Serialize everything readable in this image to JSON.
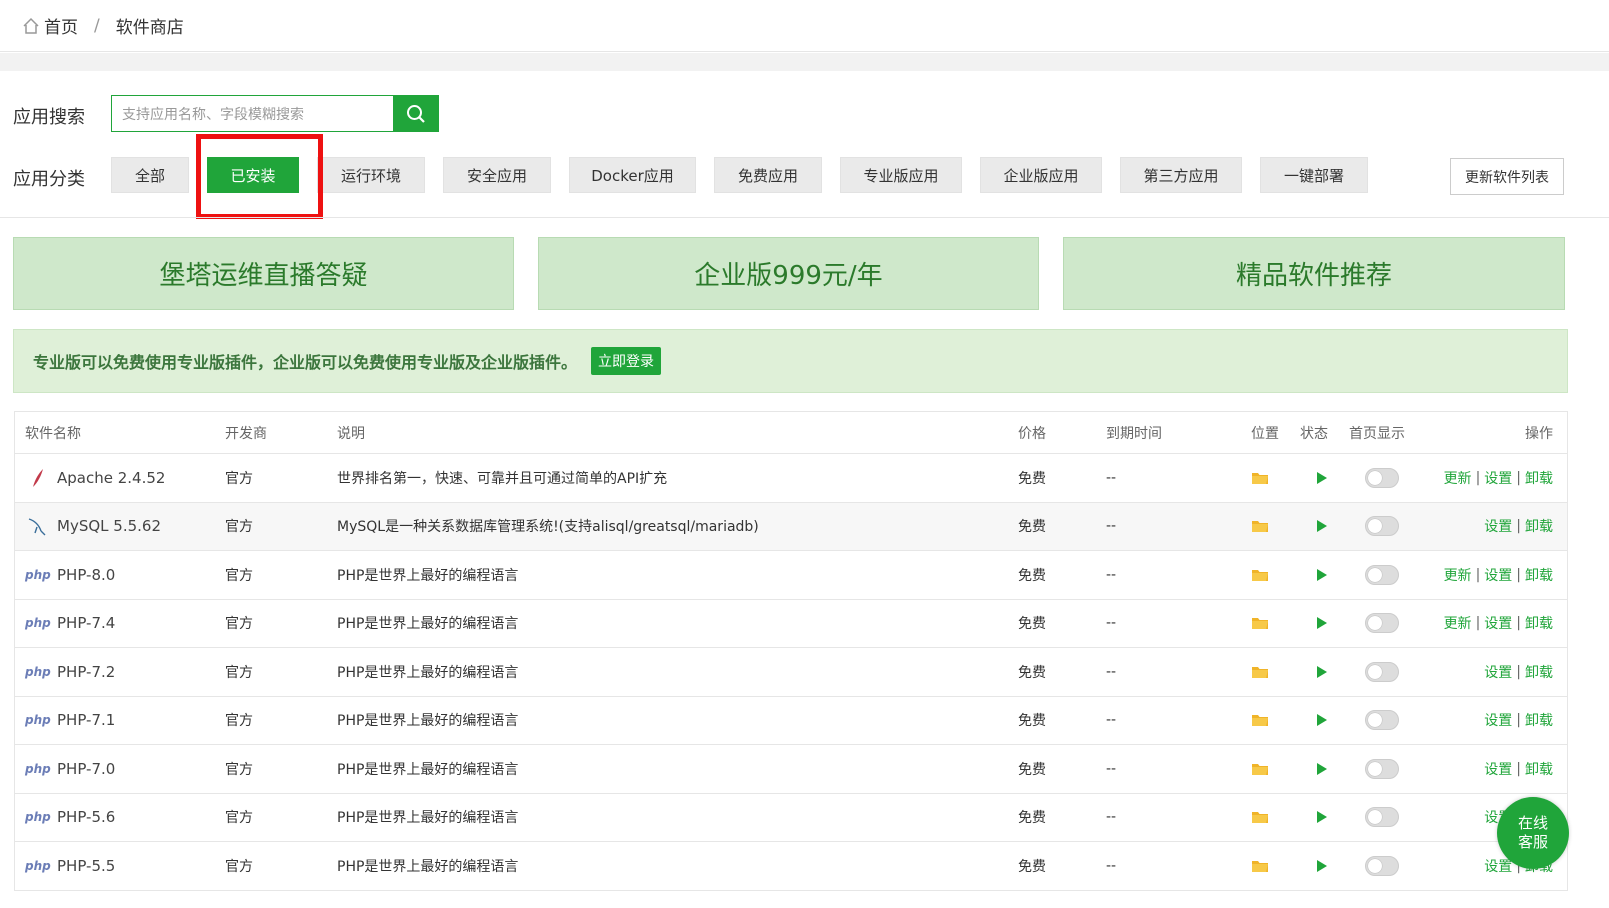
{
  "breadcrumb": {
    "home": "首页",
    "separator": "/",
    "current": "软件商店"
  },
  "search": {
    "label": "应用搜索",
    "placeholder": "支持应用名称、字段模糊搜索"
  },
  "categories": {
    "label": "应用分类",
    "items": [
      "全部",
      "已安装",
      "运行环境",
      "安全应用",
      "Docker应用",
      "免费应用",
      "专业版应用",
      "企业版应用",
      "第三方应用",
      "一键部署"
    ],
    "active": "已安装"
  },
  "update_list_label": "更新软件列表",
  "banners": [
    "堡塔运维直播答疑",
    "企业版999元/年",
    "精品软件推荐"
  ],
  "notice": {
    "text": "专业版可以免费使用专业版插件，企业版可以免费使用专业版及企业版插件。",
    "button": "立即登录"
  },
  "table": {
    "headers": {
      "name": "软件名称",
      "developer": "开发商",
      "desc": "说明",
      "price": "价格",
      "expire": "到期时间",
      "location": "位置",
      "status": "状态",
      "home": "首页显示",
      "ops": "操作"
    },
    "rows": [
      {
        "icon": "feather",
        "name": "Apache 2.4.52",
        "developer": "官方",
        "desc": "世界排名第一，快速、可靠并且可通过简单的API扩充",
        "price": "免费",
        "expire": "--",
        "ops": [
          "更新",
          "设置",
          "卸载"
        ]
      },
      {
        "icon": "dolphin",
        "name": "MySQL 5.5.62",
        "developer": "官方",
        "desc": "MySQL是一种关系数据库管理系统!(支持alisql/greatsql/mariadb)",
        "price": "免费",
        "expire": "--",
        "ops": [
          "设置",
          "卸载"
        ]
      },
      {
        "icon": "php",
        "name": "PHP-8.0",
        "developer": "官方",
        "desc": "PHP是世界上最好的编程语言",
        "price": "免费",
        "expire": "--",
        "ops": [
          "更新",
          "设置",
          "卸载"
        ]
      },
      {
        "icon": "php",
        "name": "PHP-7.4",
        "developer": "官方",
        "desc": "PHP是世界上最好的编程语言",
        "price": "免费",
        "expire": "--",
        "ops": [
          "更新",
          "设置",
          "卸载"
        ]
      },
      {
        "icon": "php",
        "name": "PHP-7.2",
        "developer": "官方",
        "desc": "PHP是世界上最好的编程语言",
        "price": "免费",
        "expire": "--",
        "ops": [
          "设置",
          "卸载"
        ]
      },
      {
        "icon": "php",
        "name": "PHP-7.1",
        "developer": "官方",
        "desc": "PHP是世界上最好的编程语言",
        "price": "免费",
        "expire": "--",
        "ops": [
          "设置",
          "卸载"
        ]
      },
      {
        "icon": "php",
        "name": "PHP-7.0",
        "developer": "官方",
        "desc": "PHP是世界上最好的编程语言",
        "price": "免费",
        "expire": "--",
        "ops": [
          "设置",
          "卸载"
        ]
      },
      {
        "icon": "php",
        "name": "PHP-5.6",
        "developer": "官方",
        "desc": "PHP是世界上最好的编程语言",
        "price": "免费",
        "expire": "--",
        "ops": [
          "设置",
          "卸载"
        ]
      },
      {
        "icon": "php",
        "name": "PHP-5.5",
        "developer": "官方",
        "desc": "PHP是世界上最好的编程语言",
        "price": "免费",
        "expire": "--",
        "ops": [
          "设置",
          "卸载"
        ]
      }
    ]
  },
  "chat": {
    "line1": "在线",
    "line2": "客服"
  },
  "php_logo_text": "php",
  "colors": {
    "accent": "#20a53a",
    "highlight": "#ee1111"
  }
}
